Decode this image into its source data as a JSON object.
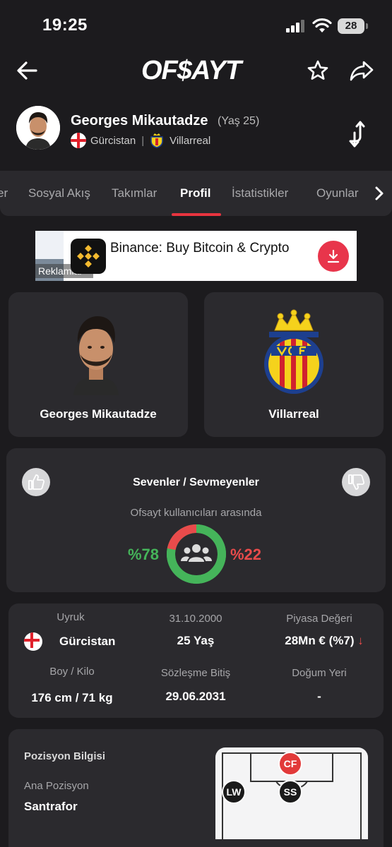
{
  "status_bar": {
    "time": "19:25",
    "battery": "28"
  },
  "header": {
    "logo": "OF$AYT"
  },
  "player": {
    "name": "Georges Mikautadze",
    "age": "(Yaş 25)",
    "country": "Gürcistan",
    "separator": "|",
    "club": "Villarreal"
  },
  "tabs": [
    {
      "label": "er"
    },
    {
      "label": "Sosyal Akış"
    },
    {
      "label": "Takımlar"
    },
    {
      "label": "Profil"
    },
    {
      "label": "İstatistikler"
    },
    {
      "label": "Oyunlar"
    }
  ],
  "ad": {
    "title": "Binance: Buy Bitcoin & Crypto",
    "label": "Reklamlar"
  },
  "cards": {
    "player_name": "Georges Mikautadze",
    "club_name": "Villarreal"
  },
  "likes": {
    "title": "Sevenler / Sevmeyenler",
    "subtitle": "Ofsayt kullanıcıları arasında",
    "like_pct_label": "%78",
    "dislike_pct_label": "%22",
    "like_fraction": 0.78,
    "colors": {
      "like": "#45b45a",
      "dislike": "#e84b4b"
    }
  },
  "info": {
    "nationality_label": "Uyruk",
    "nationality_value": "Gürcistan",
    "birthdate_label": "31.10.2000",
    "age_value": "25 Yaş",
    "market_label": "Piyasa Değeri",
    "market_value": "28Mn € (%7)",
    "market_trend": "↓",
    "height_label": "Boy / Kilo",
    "height_value": "176 cm / 71 kg",
    "contract_label": "Sözleşme Bitiş",
    "contract_value": "29.06.2031",
    "birthplace_label": "Doğum Yeri",
    "birthplace_value": "-"
  },
  "position": {
    "title": "Pozisyon Bilgisi",
    "main_label": "Ana Pozisyon",
    "main_value": "Santrafor",
    "pitch_positions": [
      {
        "code": "CF",
        "highlight": true
      },
      {
        "code": "LW",
        "highlight": false
      },
      {
        "code": "SS",
        "highlight": false
      }
    ]
  }
}
